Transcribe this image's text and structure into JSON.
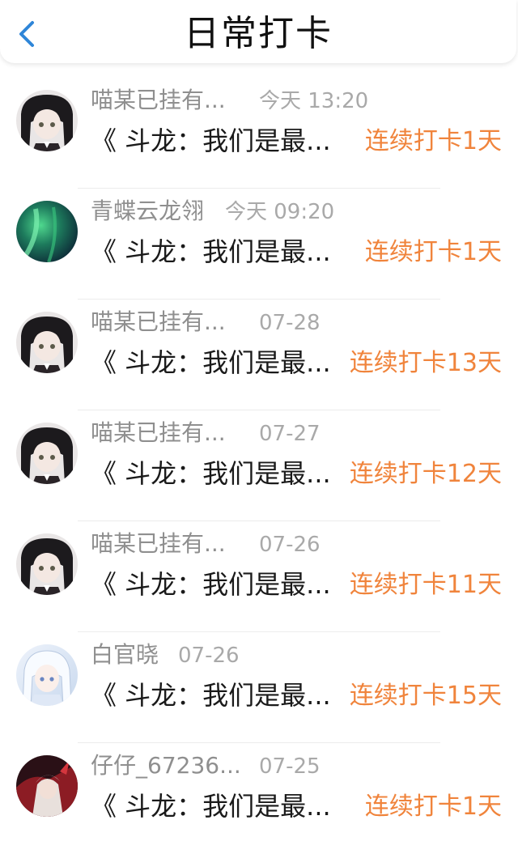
{
  "header": {
    "title": "日常打卡"
  },
  "items": [
    {
      "name": "喵某已挂有...",
      "time": "今天 13:20",
      "book": "《 斗龙：我们是最...",
      "streak": "连续打卡1天",
      "avatar": "dark-hair-girl-avatar"
    },
    {
      "name": "青蝶云龙翎",
      "time": "今天 09:20",
      "book": "《 斗龙：我们是最...",
      "streak": "连续打卡1天",
      "avatar": "aurora-avatar"
    },
    {
      "name": "喵某已挂有...",
      "time": "07-28",
      "book": "《 斗龙：我们是最...",
      "streak": "连续打卡13天",
      "avatar": "dark-hair-girl-avatar"
    },
    {
      "name": "喵某已挂有...",
      "time": "07-27",
      "book": "《 斗龙：我们是最...",
      "streak": "连续打卡12天",
      "avatar": "dark-hair-girl-avatar"
    },
    {
      "name": "喵某已挂有...",
      "time": "07-26",
      "book": "《 斗龙：我们是最...",
      "streak": "连续打卡11天",
      "avatar": "dark-hair-girl-avatar"
    },
    {
      "name": "白官晓",
      "time": "07-26",
      "book": "《 斗龙：我们是最...",
      "streak": "连续打卡15天",
      "avatar": "white-hair-girl-avatar"
    },
    {
      "name": "仔仔_67236...",
      "time": "07-25",
      "book": "《 斗龙：我们是最...",
      "streak": "连续打卡1天",
      "avatar": "red-dark-character-avatar"
    }
  ],
  "colors": {
    "accent": "#f0843c",
    "back": "#2f86d8",
    "name": "#8f8f8f",
    "time": "#a9a9a9",
    "text": "#1a1a1a"
  }
}
